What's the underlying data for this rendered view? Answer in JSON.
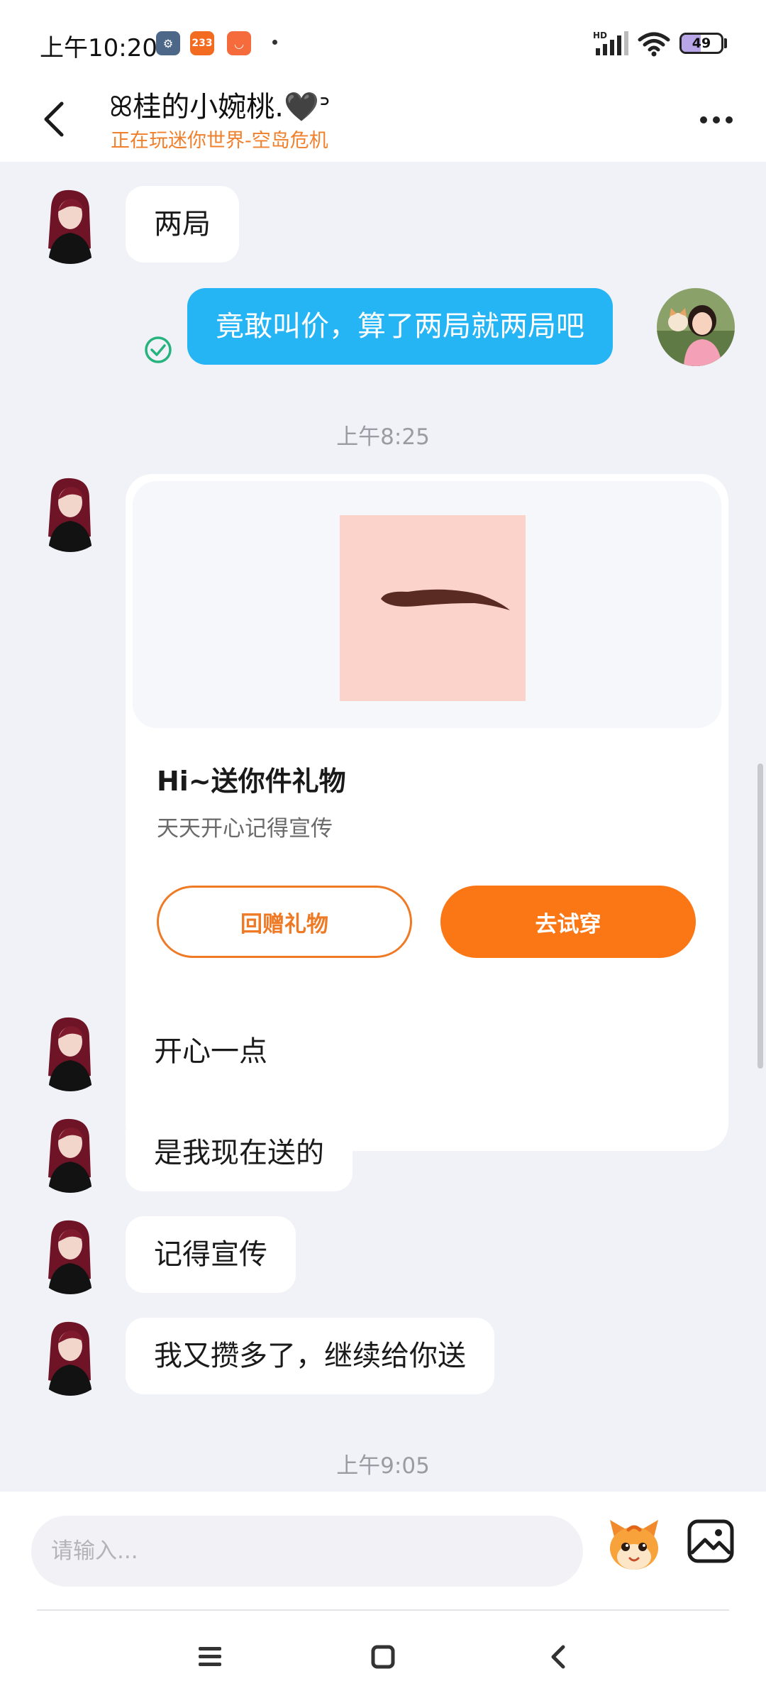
{
  "status_bar": {
    "time": "上午10:20",
    "apps": [
      {
        "name": "settings-app-icon",
        "label": "⚙",
        "color": "#4d6788"
      },
      {
        "name": "app-233-icon",
        "label": "233",
        "color": "#f36a21"
      },
      {
        "name": "mi-store-icon",
        "label": "◡",
        "color": "#f56b3c"
      }
    ],
    "network_label": "HD",
    "battery": "49",
    "battery_level": 0.49
  },
  "header": {
    "back_icon": "back-arrow-icon",
    "title": "ꕤ桂的小婉桃.🖤ᐣ",
    "status": "正在玩迷你世界-空岛危机",
    "more_icon": "more-dots-icon"
  },
  "messages": [
    {
      "id": "m1",
      "side": "left",
      "text": "两局"
    },
    {
      "id": "m2",
      "side": "right",
      "text": "竟敢叫价，算了两局就两局吧",
      "read_state": "sent-check-icon"
    },
    {
      "id": "t1",
      "type": "timestamp",
      "text": "上午8:25"
    },
    {
      "id": "gift",
      "type": "gift-card",
      "title": "Hi~送你件礼物",
      "description": "天天开心记得宣传",
      "secondary_button": "回赠礼物",
      "primary_button": "去试穿",
      "image": "eyebrow-gift-image"
    },
    {
      "id": "m3",
      "side": "left",
      "text": "开心一点"
    },
    {
      "id": "m4",
      "side": "left",
      "text": "是我现在送的"
    },
    {
      "id": "m5",
      "side": "left",
      "text": "记得宣传"
    },
    {
      "id": "m6",
      "side": "left",
      "text": "我又攒多了，继续给你送"
    },
    {
      "id": "t2",
      "type": "timestamp",
      "text": "上午9:05"
    }
  ],
  "input": {
    "placeholder": "请输入...",
    "value": "",
    "mascot_icon": "mascot-emoji-icon",
    "image_icon": "image-picker-icon"
  },
  "nav": {
    "items": [
      "menu-icon",
      "home-icon",
      "back-icon"
    ]
  },
  "colors": {
    "accent": "#fb7614",
    "my_bubble": "#25b4f4",
    "status_orange": "#f0802c",
    "check_green": "#26b37e"
  }
}
